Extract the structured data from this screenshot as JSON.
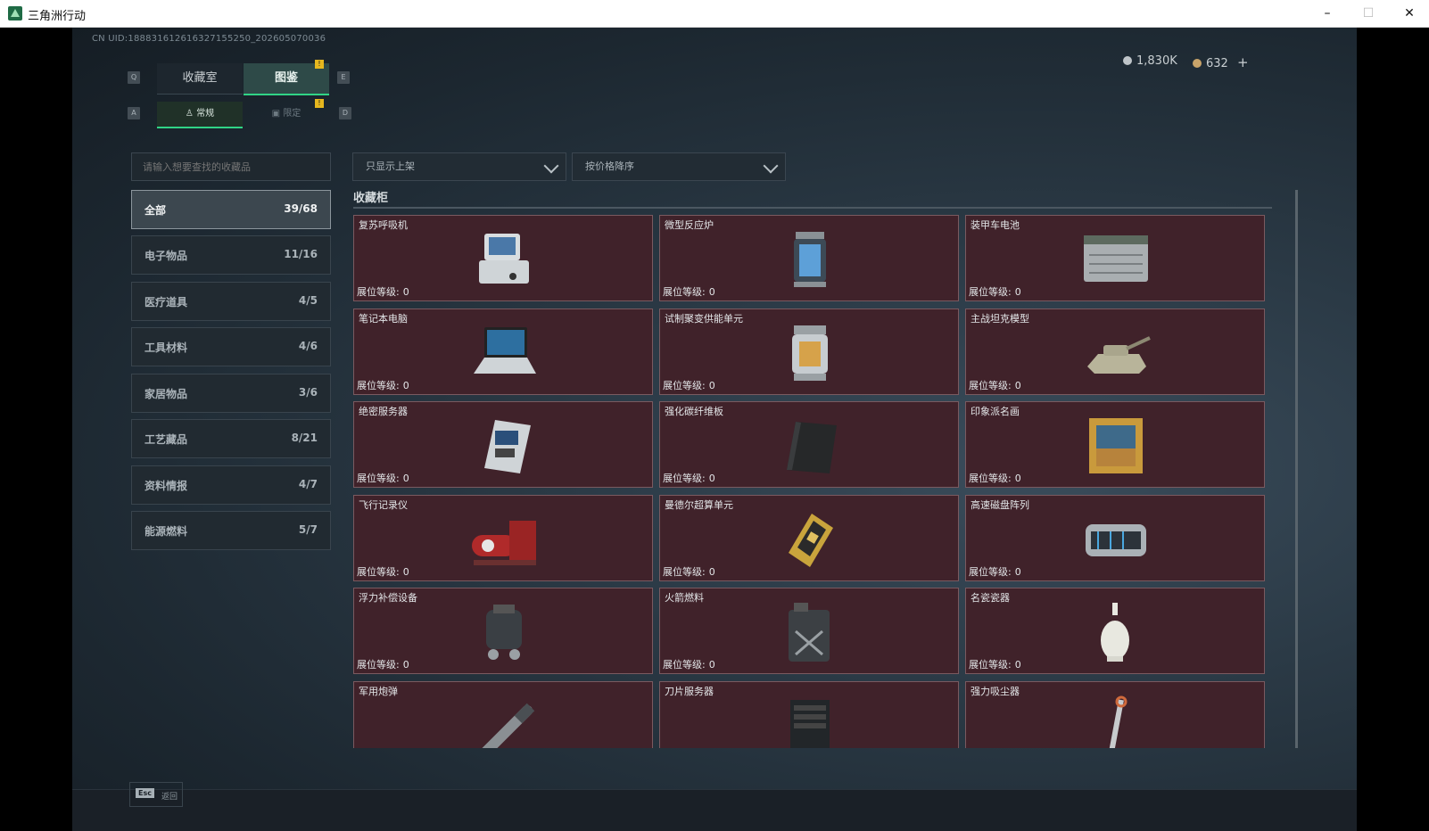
{
  "window": {
    "title": "三角洲行动",
    "minimize": "–",
    "maximize": "☐",
    "close": "✕"
  },
  "uid": "CN UID:1888316126163271552​50_202605070036",
  "tabs": {
    "left_key": "Q",
    "right_key": "E",
    "collection": "收藏室",
    "catalog": "图鉴",
    "badge": "!"
  },
  "subtabs": {
    "left_key": "A",
    "right_key": "D",
    "normal": "常规",
    "limited": "限定",
    "badge": "!"
  },
  "currency": [
    {
      "value": "1,830K",
      "color": "#bfc5c9"
    },
    {
      "value": "632",
      "color": "#c9a46a",
      "plus": "+"
    }
  ],
  "search": {
    "placeholder": "请输入想要查找的收藏品"
  },
  "filters": {
    "shelf": "只显示上架",
    "sort": "按价格降序"
  },
  "categories": [
    {
      "label": "全部",
      "count": "39/68"
    },
    {
      "label": "电子物品",
      "count": "11/16"
    },
    {
      "label": "医疗道具",
      "count": "4/5"
    },
    {
      "label": "工具材料",
      "count": "4/6"
    },
    {
      "label": "家居物品",
      "count": "3/6"
    },
    {
      "label": "工艺藏品",
      "count": "8/21"
    },
    {
      "label": "资料情报",
      "count": "4/7"
    },
    {
      "label": "能源燃料",
      "count": "5/7"
    }
  ],
  "section_title": "收藏柜",
  "level_label": "展位等级:",
  "items": [
    {
      "name": "复苏呼吸机",
      "level": "0",
      "icon": "ventilator-icon"
    },
    {
      "name": "微型反应炉",
      "level": "0",
      "icon": "reactor-icon"
    },
    {
      "name": "装甲车电池",
      "level": "0",
      "icon": "battery-icon"
    },
    {
      "name": "笔记本电脑",
      "level": "0",
      "icon": "laptop-icon"
    },
    {
      "name": "试制聚变供能单元",
      "level": "0",
      "icon": "fusion-unit-icon"
    },
    {
      "name": "主战坦克模型",
      "level": "0",
      "icon": "tank-model-icon"
    },
    {
      "name": "绝密服务器",
      "level": "0",
      "icon": "server-board-icon"
    },
    {
      "name": "强化碳纤维板",
      "level": "0",
      "icon": "carbon-plate-icon"
    },
    {
      "name": "印象派名画",
      "level": "0",
      "icon": "painting-icon"
    },
    {
      "name": "飞行记录仪",
      "level": "0",
      "icon": "flight-recorder-icon"
    },
    {
      "name": "曼德尔超算单元",
      "level": "0",
      "icon": "chip-icon"
    },
    {
      "name": "高速磁盘阵列",
      "level": "0",
      "icon": "disk-array-icon"
    },
    {
      "name": "浮力补偿设备",
      "level": "0",
      "icon": "bcd-vest-icon"
    },
    {
      "name": "火箭燃料",
      "level": "0",
      "icon": "fuel-can-icon"
    },
    {
      "name": "名瓷瓷器",
      "level": "0",
      "icon": "vase-icon"
    },
    {
      "name": "军用炮弹",
      "level": "",
      "icon": "shell-icon"
    },
    {
      "name": "刀片服务器",
      "level": "",
      "icon": "blade-server-icon"
    },
    {
      "name": "强力吸尘器",
      "level": "",
      "icon": "vacuum-icon"
    }
  ],
  "esc": {
    "key": "Esc",
    "label": "返回"
  }
}
